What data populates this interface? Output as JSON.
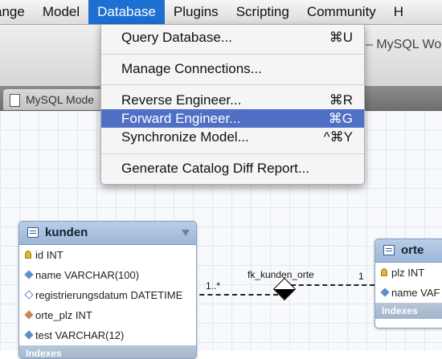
{
  "menubar": {
    "items": [
      "ange",
      "Model",
      "Database",
      "Plugins",
      "Scripting",
      "Community",
      "H"
    ],
    "active_index": 2
  },
  "window": {
    "title_fragment": "– MySQL Wo",
    "tab_label": "MySQL Mode"
  },
  "database_menu": {
    "items": [
      {
        "label": "Query Database...",
        "shortcut": "⌘U"
      },
      {
        "label": "Manage Connections...",
        "shortcut": ""
      },
      {
        "label": "Reverse Engineer...",
        "shortcut": "⌘R"
      },
      {
        "label": "Forward Engineer...",
        "shortcut": "⌘G",
        "highlighted": true
      },
      {
        "label": "Synchronize Model...",
        "shortcut": "^⌘Y"
      },
      {
        "label": "Generate Catalog Diff Report...",
        "shortcut": ""
      }
    ],
    "highlight_color": "#4f70c4"
  },
  "diagram": {
    "entities": [
      {
        "name": "kunden",
        "columns": [
          {
            "text": "id INT",
            "icon": "primary-key-icon"
          },
          {
            "text": "name VARCHAR(100)",
            "icon": "filled-blue-diamond-icon"
          },
          {
            "text": "registrierungsdatum DATETIME",
            "icon": "empty-diamond-icon"
          },
          {
            "text": "orte_plz INT",
            "icon": "foreign-key-diamond-icon"
          },
          {
            "text": "test VARCHAR(12)",
            "icon": "filled-blue-diamond-icon"
          }
        ],
        "indexes_label": "Indexes"
      },
      {
        "name": "orte",
        "columns": [
          {
            "text": "plz INT",
            "icon": "primary-key-icon"
          },
          {
            "text": "name VAF",
            "icon": "filled-blue-diamond-icon"
          }
        ],
        "indexes_label": "Indexes"
      }
    ],
    "relationship": {
      "name": "fk_kunden_orte",
      "left_cardinality": "1..*",
      "right_cardinality": "1"
    }
  },
  "colors": {
    "menu_active": "#1e6fd1",
    "entity_header": "#9db7d9"
  }
}
